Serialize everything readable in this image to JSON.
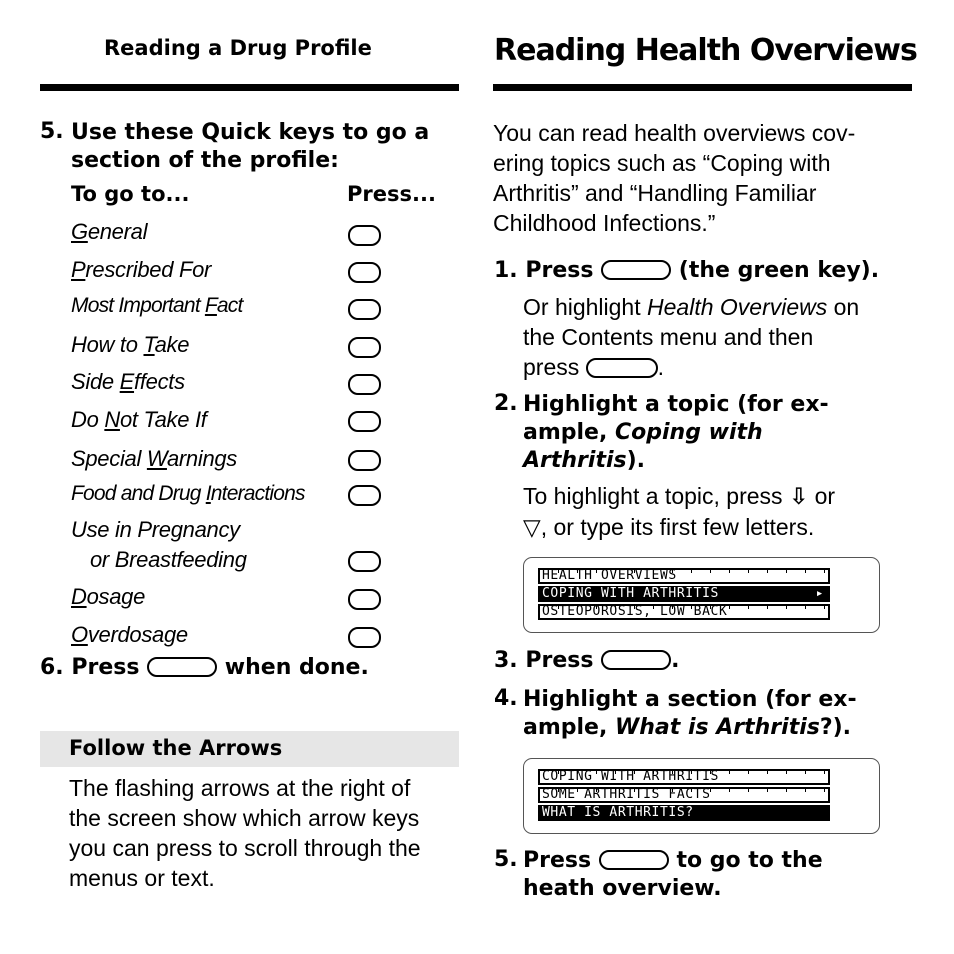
{
  "left": {
    "header": "Reading a Drug Profile",
    "step5": {
      "num": "5.",
      "text_line1": "Use these Quick keys to go a",
      "text_line2": "section of the profile:"
    },
    "table_headers": {
      "col1": "To go to...",
      "col2": "Press..."
    },
    "rows": [
      {
        "pre": "",
        "u": "G",
        "post": "eneral",
        "key": "key-icon"
      },
      {
        "pre": "",
        "u": "P",
        "post": "rescribed For",
        "key": "key-icon"
      },
      {
        "pre": "Most Important ",
        "u": "F",
        "post": "act",
        "key": "key-icon"
      },
      {
        "pre": "How to ",
        "u": "T",
        "post": "ake",
        "key": "key-icon"
      },
      {
        "pre": "Side ",
        "u": "E",
        "post": "ffects",
        "key": "key-icon"
      },
      {
        "pre": "Do ",
        "u": "N",
        "post": "ot Take If",
        "key": "key-icon"
      },
      {
        "pre": "Special ",
        "u": "W",
        "post": "arnings",
        "key": "key-icon"
      },
      {
        "pre": "Food and Drug ",
        "u": "I",
        "post": "nteractions",
        "key": "key-icon"
      },
      {
        "pre": "Use in Pregnancy",
        "u": "",
        "post": "",
        "line2": "or Breastfeeding",
        "key": "key-icon"
      },
      {
        "pre": "",
        "u": "D",
        "post": "osage",
        "key": "key-icon"
      },
      {
        "pre": "",
        "u": "O",
        "post": "verdosage",
        "key": "key-icon"
      }
    ],
    "step6": {
      "num": "6.",
      "before": "Press",
      "after": "when done."
    },
    "tip": {
      "title": "Follow the Arrows",
      "lines": [
        "The flashing arrows at the right of",
        "the screen show which arrow keys",
        "you can press to scroll through the",
        "menus or text."
      ]
    }
  },
  "right": {
    "header": "Reading Health Overviews",
    "intro": [
      "You can read health overviews cov-",
      "ering topics such as “Coping with",
      "Arthritis” and “Handling Familiar",
      "Childhood Infections.”"
    ],
    "step1": {
      "num": "1.",
      "before": "Press",
      "after": "(the green key).",
      "sub1_pre": "Or highlight ",
      "sub1_it": "Health Overviews",
      "sub1_post": " on",
      "sub2": "the Contents menu and then",
      "sub3_pre": "press",
      "sub3_post": "."
    },
    "step2": {
      "num": "2.",
      "line1": "Highlight a topic (for ex-",
      "line2_pre": "ample, ",
      "line2_it": "Coping with",
      "line3_it": "Arthritis",
      "line3_post": ").",
      "sub1_pre": "To highlight a topic, press",
      "sub1_post": "or",
      "sub2": ", or type its first few letters."
    },
    "screen1": {
      "lines": [
        "HEALTH OVERVIEWS",
        "COPING WITH ARTHRITIS",
        "OSTEOPOROSIS, LOW BACK"
      ],
      "highlighted_index": 1,
      "arrow": "▸"
    },
    "step3": {
      "num": "3.",
      "before": "Press",
      "after": "."
    },
    "step4": {
      "num": "4.",
      "line1": "Highlight a section (for ex-",
      "line2_pre": "ample, ",
      "line2_it": "What is Arthritis",
      "line2_post": "?)."
    },
    "screen2": {
      "lines": [
        "COPING WITH ARTHRITIS",
        "SOME ARTHRITIS FACTS",
        "WHAT IS ARTHRITIS?"
      ],
      "highlighted_index": 2
    },
    "step5": {
      "num": "5.",
      "before": "Press",
      "after": "to go to the",
      "line2": "heath overview."
    },
    "icons": {
      "down_arrow": "⇩",
      "down_triangle": "▽"
    }
  }
}
